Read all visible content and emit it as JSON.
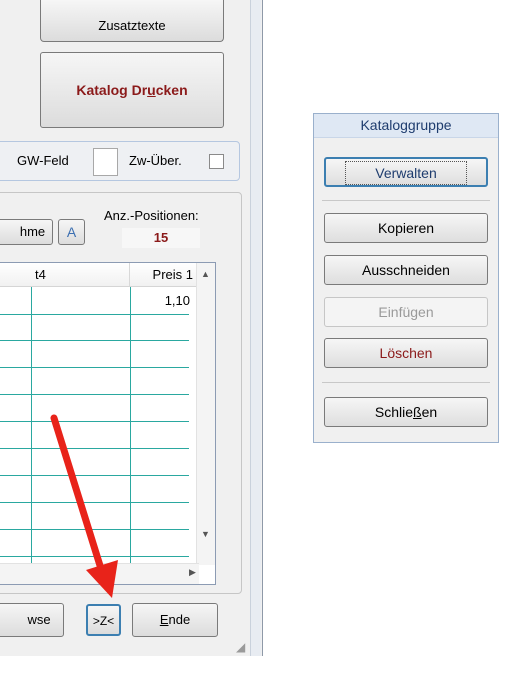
{
  "left_window": {
    "zusatztexte_label": "Zusatztexte",
    "katalog_drucken": {
      "pre": "Katalog Dr",
      "accel": "u",
      "post": "cken"
    },
    "gw_feld_label": "GW-Feld",
    "zw_ueber_label": "Zw-Über.",
    "nahme_button_label": "hme",
    "a_button_label": "A",
    "anz_positionen_label": "Anz.-Positionen:",
    "anz_positionen_value": "15",
    "grid": {
      "headers": [
        "t4",
        "Preis 1"
      ],
      "rows": [
        {
          "preis1": "1,10"
        }
      ]
    },
    "browse_button_label": "wse",
    "z_button_label": ">Z<",
    "ende": {
      "accel": "E",
      "post": "nde"
    }
  },
  "dialog": {
    "title": "Kataloggruppe",
    "verwalten_label": "Verwalten",
    "kopieren_label": "Kopieren",
    "ausschneiden_label": "Ausschneiden",
    "einfuegen_label": "Einfügen",
    "loeschen_label": "Löschen",
    "schliessen": {
      "pre": "Schlie",
      "accel": "ß",
      "post": "en"
    }
  },
  "colors": {
    "accent_red": "#8b1a1a",
    "annotation_arrow": "#e8231a",
    "grid_lines": "#2aa8a0",
    "focus_blue": "#3c7fb1"
  }
}
